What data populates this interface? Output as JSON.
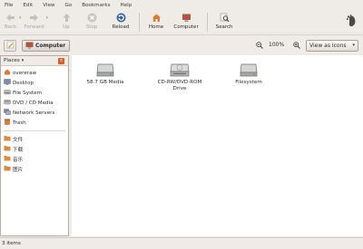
{
  "menu": [
    "File",
    "Edit",
    "View",
    "Go",
    "Bookmarks",
    "Help"
  ],
  "toolbar": {
    "back": "Back",
    "forward": "Forward",
    "up": "Up",
    "stop": "Stop",
    "reload": "Reload",
    "home": "Home",
    "computer": "Computer",
    "search": "Search"
  },
  "location": {
    "crumb": "Computer",
    "zoom": "100%",
    "view_mode": "View as Icons"
  },
  "sidebar": {
    "header": "Places",
    "items": [
      "overeraw",
      "Desktop",
      "File System",
      "DVD / CD Media",
      "Network Servers",
      "Trash"
    ],
    "bookmarks": [
      "文件",
      "下载",
      "音乐",
      "图片"
    ]
  },
  "files": [
    "58.7 GB Media",
    "CD-RW/DVD-ROM Drive",
    "Filesystem"
  ],
  "status": "3 items",
  "colors": {
    "accent": "#e05a1f",
    "reload": "#3465a4",
    "folder": "#d98a3a"
  }
}
